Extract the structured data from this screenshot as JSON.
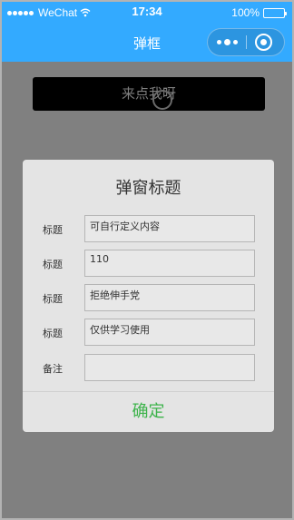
{
  "status_bar": {
    "carrier": "WeChat",
    "time": "17:34",
    "battery_percent": "100%",
    "battery_level": 1.0
  },
  "nav_bar": {
    "title": "弹框",
    "background_color": "#33aaff",
    "capsule": {
      "more_icon": "more-dots-icon",
      "close_icon": "target-close-icon"
    }
  },
  "page": {
    "trigger_button_label": "来点我呀",
    "overlay_color": "#808080"
  },
  "modal": {
    "title": "弹窗标题",
    "rows": [
      {
        "label": "标题",
        "value": "可自行定义内容"
      },
      {
        "label": "标题",
        "value": "110"
      },
      {
        "label": "标题",
        "value": "拒绝伸手党"
      },
      {
        "label": "标题",
        "value": "仅供学习使用"
      },
      {
        "label": "备注",
        "value": ""
      }
    ],
    "confirm_label": "确定",
    "confirm_color": "#3cb34a"
  }
}
